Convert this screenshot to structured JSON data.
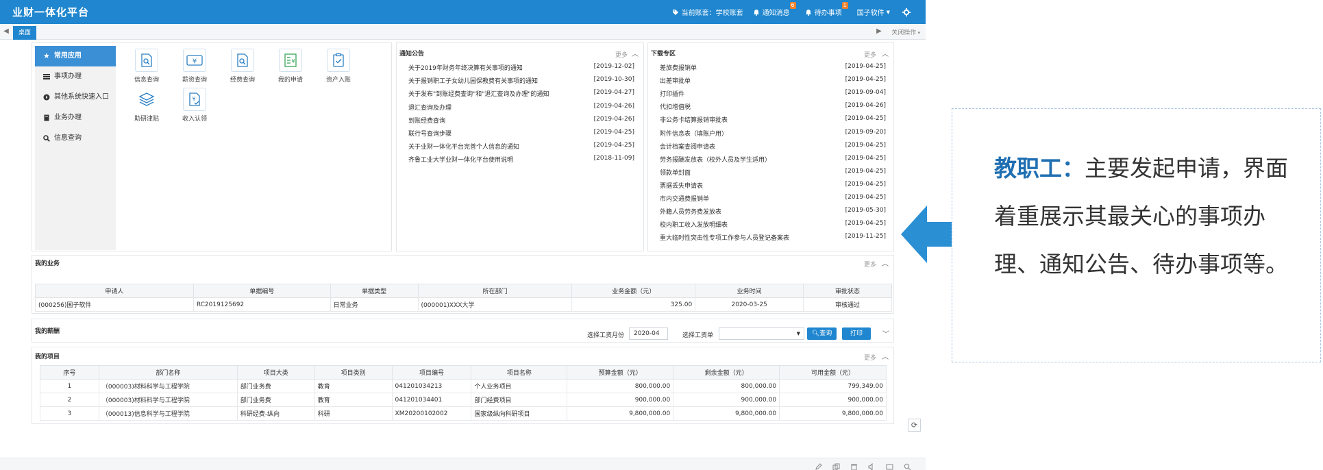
{
  "header": {
    "title": "业财一体化平台",
    "current_set": "当前账套：学校账套",
    "notice_label": "通知消息",
    "notice_count": "6",
    "todo_label": "待办事项",
    "todo_count": "1",
    "user": "国子软件",
    "icons": [
      "tag-icon",
      "bell-icon",
      "bell-icon",
      "gear-icon"
    ]
  },
  "tabs": {
    "desk": "桌面",
    "close_ops": "关闭操作"
  },
  "sidebar": {
    "items": [
      {
        "label": "常用应用",
        "icon": "star-icon",
        "active": true
      },
      {
        "label": "事项办理",
        "icon": "list-icon"
      },
      {
        "label": "其他系统快速入口",
        "icon": "compass-icon"
      },
      {
        "label": "业务办理",
        "icon": "book-icon"
      },
      {
        "label": "信息查询",
        "icon": "search-icon"
      }
    ]
  },
  "apps": [
    {
      "label": "信息查询",
      "icon": "doc-search-icon"
    },
    {
      "label": "薪资查询",
      "icon": "yen-icon"
    },
    {
      "label": "经费查询",
      "icon": "doc-search-icon"
    },
    {
      "label": "我的申请",
      "icon": "yen-list-icon"
    },
    {
      "label": "资产入账",
      "icon": "clipboard-icon"
    },
    {
      "label": "助研津贴",
      "icon": "layers-icon"
    },
    {
      "label": "收入认领",
      "icon": "doc-check-icon"
    }
  ],
  "notices": {
    "title": "通知公告",
    "more": "更多",
    "items": [
      {
        "text": "关于2019年财务年终决算有关事项的通知",
        "date": "[2019-12-02]"
      },
      {
        "text": "关于报销职工子女幼儿园保教费有关事项的通知",
        "date": "[2019-10-30]"
      },
      {
        "text": "关于发布\"到账经费查询\"和\"退汇查询及办理\"的通知",
        "date": "[2019-04-27]"
      },
      {
        "text": "退汇查询及办理",
        "date": "[2019-04-26]"
      },
      {
        "text": "到账经费查询",
        "date": "[2019-04-26]"
      },
      {
        "text": "联行号查询步骤",
        "date": "[2019-04-25]"
      },
      {
        "text": "关于业财一体化平台完善个人信息的通知",
        "date": "[2019-04-25]"
      },
      {
        "text": "齐鲁工业大学业财一体化平台使用说明",
        "date": "[2018-11-09]"
      }
    ]
  },
  "downloads": {
    "title": "下载专区",
    "more": "更多",
    "items": [
      {
        "text": "差旅费报销单",
        "date": "[2019-04-25]"
      },
      {
        "text": "出差审批单",
        "date": "[2019-04-25]"
      },
      {
        "text": "打印插件",
        "date": "[2019-09-04]"
      },
      {
        "text": "代扣增值税",
        "date": "[2019-04-26]"
      },
      {
        "text": "非公务卡结算报销审批表",
        "date": "[2019-04-25]"
      },
      {
        "text": "附件信息表（填账户用）",
        "date": "[2019-09-20]"
      },
      {
        "text": "会计档案查阅申请表",
        "date": "[2019-04-25]"
      },
      {
        "text": "劳务报酬发放表（校外人员及学生适用）",
        "date": "[2019-04-25]"
      },
      {
        "text": "领款单封面",
        "date": "[2019-04-25]"
      },
      {
        "text": "票据丢失申请表",
        "date": "[2019-04-25]"
      },
      {
        "text": "市内交通费报销单",
        "date": "[2019-04-25]"
      },
      {
        "text": "外籍人员劳务费发放表",
        "date": "[2019-05-30]"
      },
      {
        "text": "校内职工收入发放明细表",
        "date": "[2019-04-25]"
      },
      {
        "text": "重大临时性突击性专项工作参与人员登记备案表",
        "date": "[2019-11-25]"
      }
    ]
  },
  "my_business": {
    "title": "我的业务",
    "more": "更多",
    "headers": [
      "申请人",
      "单据编号",
      "单据类型",
      "所在部门",
      "业务金额（元）",
      "业务时间",
      "审批状态"
    ],
    "rows": [
      [
        "(000256)国子软件",
        "RC2019125692",
        "日常业务",
        "(000001)XXX大学",
        "325.00",
        "2020-03-25",
        "审核通过"
      ]
    ]
  },
  "my_salary": {
    "title": "我的薪酬",
    "month_label": "选择工资月份",
    "month_value": "2020-04",
    "sheet_label": "选择工资单",
    "sheet_value": "",
    "query_button": "查询",
    "print_button": "打印"
  },
  "my_projects": {
    "title": "我的项目",
    "more": "更多",
    "headers": [
      "序号",
      "部门名称",
      "项目大类",
      "项目类别",
      "项目编号",
      "项目名称",
      "预算金额（元）",
      "剩余金额（元）",
      "可用金额（元）"
    ],
    "rows": [
      [
        "1",
        "（000003)材料科学与工程学院",
        "部门业务费",
        "教育",
        "041201034213",
        "个人业务项目",
        "800,000.00",
        "800,000.00",
        "799,349.00"
      ],
      [
        "2",
        "（000003)材料科学与工程学院",
        "部门业务费",
        "教育",
        "041201034401",
        "部门经费项目",
        "900,000.00",
        "900,000.00",
        "900,000.00"
      ],
      [
        "3",
        "（000013)信息科学与工程学院",
        "科研经费-纵向",
        "科研",
        "XM20200102002",
        "国家级纵向科研项目",
        "9,800,000.00",
        "9,800,000.00",
        "9,800,000.00"
      ]
    ]
  },
  "callout": {
    "heading": "教职工：",
    "text": "主要发起申请，界面着重展示其最关心的事项办理、通知公告、待办事项等。",
    "accent": "#1f6fb2",
    "arrow_color": "#2b8fd4"
  }
}
